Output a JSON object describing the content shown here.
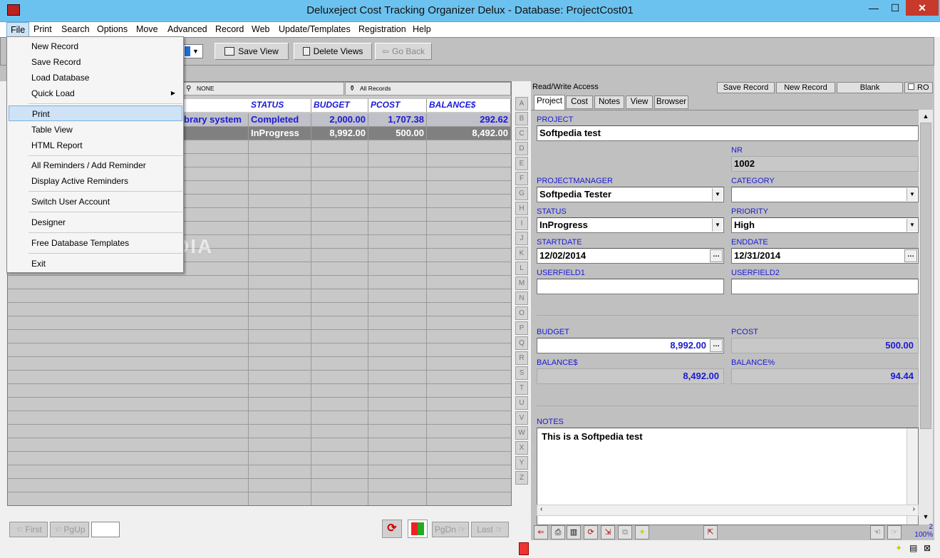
{
  "window": {
    "title": "Deluxeject Cost Tracking Organizer Delux - Database: ProjectCost01",
    "minimize": "—",
    "maximize": "☐",
    "close": "✕"
  },
  "menubar": [
    "File",
    "Print",
    "Search",
    "Options",
    "Move",
    "Advanced",
    "Record",
    "Web",
    "Update/Templates",
    "Registration",
    "Help"
  ],
  "toolbar": {
    "save_view": "Save View",
    "delete_views": "Delete Views",
    "go_back": "Go Back"
  },
  "file_menu": {
    "new_record": "New Record",
    "save_record": "Save Record",
    "load_database": "Load Database",
    "quick_load": "Quick Load",
    "print": "Print",
    "table_view": "Table View",
    "html_report": "HTML Report",
    "all_reminders": "All Reminders / Add Reminder",
    "display_reminders": "Display Active Reminders",
    "switch_user": "Switch User Account",
    "designer": "Designer",
    "free_templates": "Free Database Templates",
    "exit": "Exit"
  },
  "grid": {
    "filter_left": "NONE",
    "filter_right": "All Records",
    "columns": [
      "STATUS",
      "BUDGET",
      "PCOST",
      "BALANCE$"
    ],
    "rows": [
      {
        "project": "brary system",
        "status": "Completed",
        "budget": "2,000.00",
        "pcost": "1,707.38",
        "balance": "292.62"
      },
      {
        "project": "",
        "status": "InProgress",
        "budget": "8,992.00",
        "pcost": "500.00",
        "balance": "8,492.00"
      }
    ],
    "nav": {
      "first": "First",
      "pgup": "PgUp",
      "pgdn": "PgDn",
      "last": "Last"
    }
  },
  "letters": [
    "A",
    "B",
    "C",
    "D",
    "E",
    "F",
    "G",
    "H",
    "I",
    "J",
    "K",
    "L",
    "M",
    "N",
    "O",
    "P",
    "Q",
    "R",
    "S",
    "T",
    "U",
    "V",
    "W",
    "X",
    "Y",
    "Z"
  ],
  "form": {
    "access": "Read/Write Access",
    "save_record": "Save Record",
    "new_record": "New Record",
    "blank": "Blank",
    "ro": "RO",
    "tabs": [
      "Project",
      "Cost",
      "Notes",
      "View",
      "Browser"
    ],
    "project_label": "PROJECT",
    "project": "Softpedia test",
    "nr_label": "NR",
    "nr": "1002",
    "pm_label": "PROJECTMANAGER",
    "pm": "Softpedia Tester",
    "category_label": "CATEGORY",
    "category": "",
    "status_label": "STATUS",
    "status": "InProgress",
    "priority_label": "PRIORITY",
    "priority": "High",
    "startdate_label": "STARTDATE",
    "startdate": "12/02/2014",
    "enddate_label": "ENDDATE",
    "enddate": "12/31/2014",
    "uf1_label": "USERFIELD1",
    "uf1": "",
    "uf2_label": "USERFIELD2",
    "uf2": "",
    "budget_label": "BUDGET",
    "budget": "8,992.00",
    "pcost_label": "PCOST",
    "pcost": "500.00",
    "balance_label": "BALANCE$",
    "balance": "8,492.00",
    "balancepct_label": "BALANCE%",
    "balancepct": "94.44",
    "notes_label": "NOTES",
    "notes": "This is a Softpedia test"
  },
  "status": {
    "count": "2",
    "zoom": "100%"
  },
  "watermark": "SOFTPEDIA"
}
